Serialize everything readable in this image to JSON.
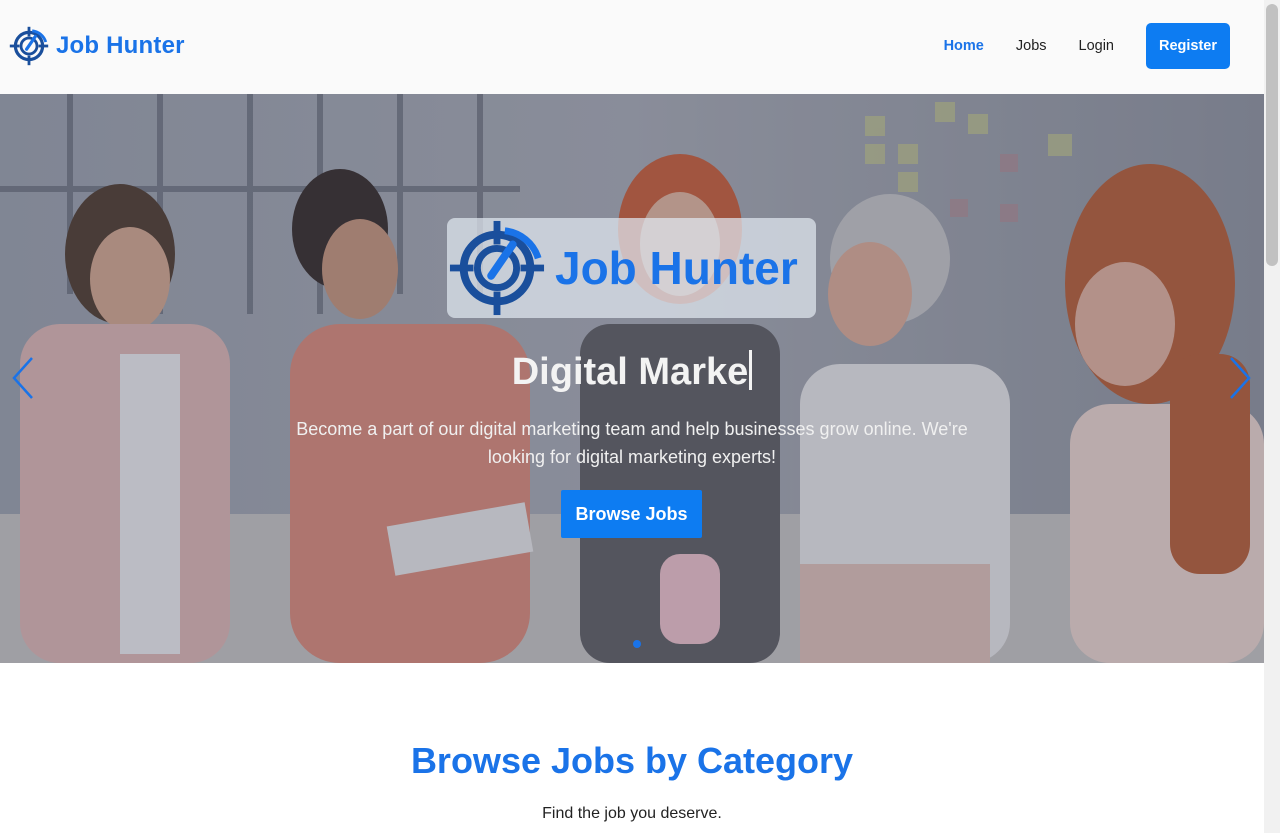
{
  "navbar": {
    "brand": "Job Hunter",
    "links": [
      {
        "label": "Home",
        "active": true
      },
      {
        "label": "Jobs",
        "active": false
      },
      {
        "label": "Login",
        "active": false
      }
    ],
    "register_label": "Register"
  },
  "hero": {
    "logo_text": "Job Hunter",
    "title": "Digital Marke",
    "description": "Become a part of our digital marketing team and help businesses grow online. We're looking for digital marketing experts!",
    "button_label": "Browse Jobs",
    "slides_count": 3,
    "active_slide": 2
  },
  "section": {
    "title": "Browse Jobs by Category",
    "subtitle": "Find the job you deserve."
  },
  "colors": {
    "brand": "#1a73e8",
    "button": "#0d7cf2"
  },
  "icons": [
    "target-logo-icon",
    "chevron-left-icon",
    "chevron-right-icon"
  ]
}
